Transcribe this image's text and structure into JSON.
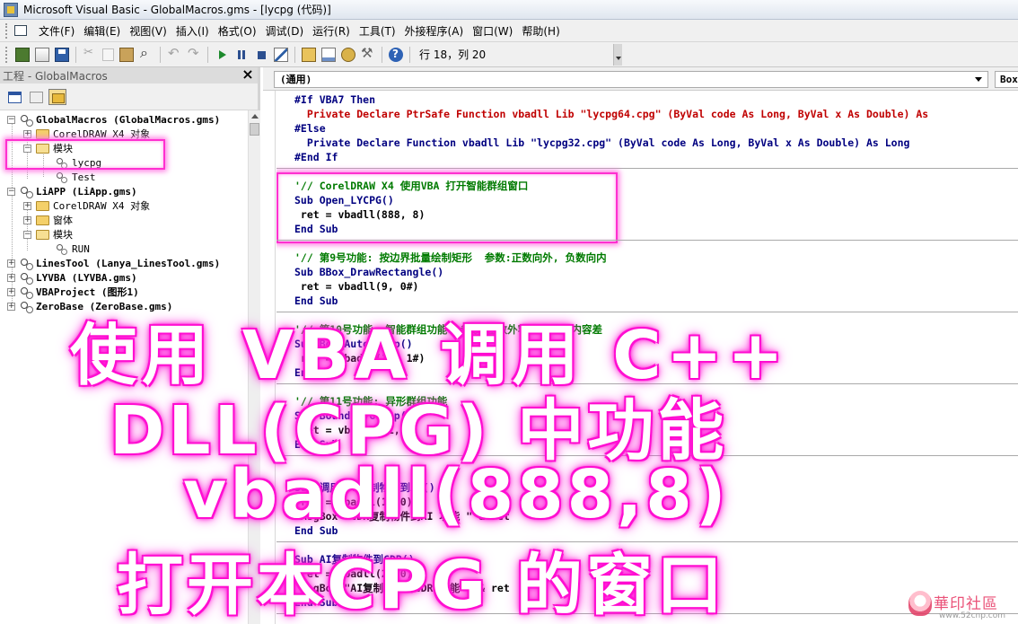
{
  "window": {
    "title": "Microsoft Visual Basic - GlobalMacros.gms - [lycpg (代码)]"
  },
  "menu": {
    "items": [
      "文件(F)",
      "编辑(E)",
      "视图(V)",
      "插入(I)",
      "格式(O)",
      "调试(D)",
      "运行(R)",
      "工具(T)",
      "外接程序(A)",
      "窗口(W)",
      "帮助(H)"
    ]
  },
  "toolbar": {
    "status": "行 18，列 20"
  },
  "project": {
    "header": "工程 - GlobalMacros",
    "close_glyph": "×",
    "nodes": [
      {
        "label": "GlobalMacros (GlobalMacros.gms)",
        "bold": true
      },
      {
        "label": "CorelDRAW X4 对象"
      },
      {
        "label": "模块"
      },
      {
        "label": "lycpg"
      },
      {
        "label": "Test"
      },
      {
        "label": "LiAPP (LiApp.gms)",
        "bold": true
      },
      {
        "label": "CorelDRAW X4 对象"
      },
      {
        "label": "窗体"
      },
      {
        "label": "模块"
      },
      {
        "label": "RUN"
      },
      {
        "label": "LinesTool (Lanya_LinesTool.gms)",
        "bold": true
      },
      {
        "label": "LYVBA (LYVBA.gms)",
        "bold": true
      },
      {
        "label": "VBAProject (图形1)",
        "bold": true
      },
      {
        "label": "ZeroBase (ZeroBase.gms)",
        "bold": true
      }
    ]
  },
  "editor": {
    "object_combo": "(通用)",
    "proc_combo": "Box",
    "code": {
      "l1_kw": "#If VBA7 Then",
      "l2": "  Private Declare PtrSafe Function vbadll Lib \"lycpg64.cpg\" (ByVal code As Long, ByVal x As Double) As",
      "l3_kw": "#Else",
      "l4": "  Private Declare Function vbadll Lib \"lycpg32.cpg\" (ByVal code As Long, ByVal x As Double) As Long",
      "l5_kw": "#End If",
      "p1_comment": "'// CorelDRAW X4 使用VBA 打开智能群组窗口",
      "p1_sub": "Sub Open_LYCPG()",
      "p1_body": " ret = vbadll(888, 8)",
      "end_sub": "End Sub",
      "p2_comment": "'// 第9号功能: 按边界批量绘制矩形  参数:正数向外, 负数向内",
      "p2_sub": "Sub BBox_DrawRectangle()",
      "p2_body": " ret = vbadll(9, 0#)",
      "p3_comment": "'// 第10号功能: 智能群组功能  参数:正数外容差, 负数内容差",
      "p3_sub": "Sub Box_AutoGroup()",
      "p3_body": " ret = vbadll(10, 1#)",
      "p4_comment": "'// 第11号功能: 异形群组功能",
      "p4_sub": "Sub BoundaryGroup()",
      "p4_body": " ret = vbadll(11, 0)",
      "p5_sub": "Sub 调用CDR复制物件到AI()",
      "p5_body": " ret = vbadll(1, 0)",
      "p5_msg": " MsgBox \"CDR复制物件到AI 功能 \" & ret",
      "p6_sub": "Sub AI复制物件到CDR()",
      "p6_body": " ret = vbadll(2, 0)",
      "p6_msg": " MsgBox \"AI复制物件到CDR 功能 \" & ret"
    }
  },
  "overlay": {
    "line1": "使用 VBA 调用 C++",
    "line2": "DLL(CPG) 中功能",
    "line3": "vbadll(888,8)",
    "line4": "打开本CPG 的窗口"
  },
  "watermark": {
    "text": "華印社區",
    "url": "www.52cnp.com"
  }
}
